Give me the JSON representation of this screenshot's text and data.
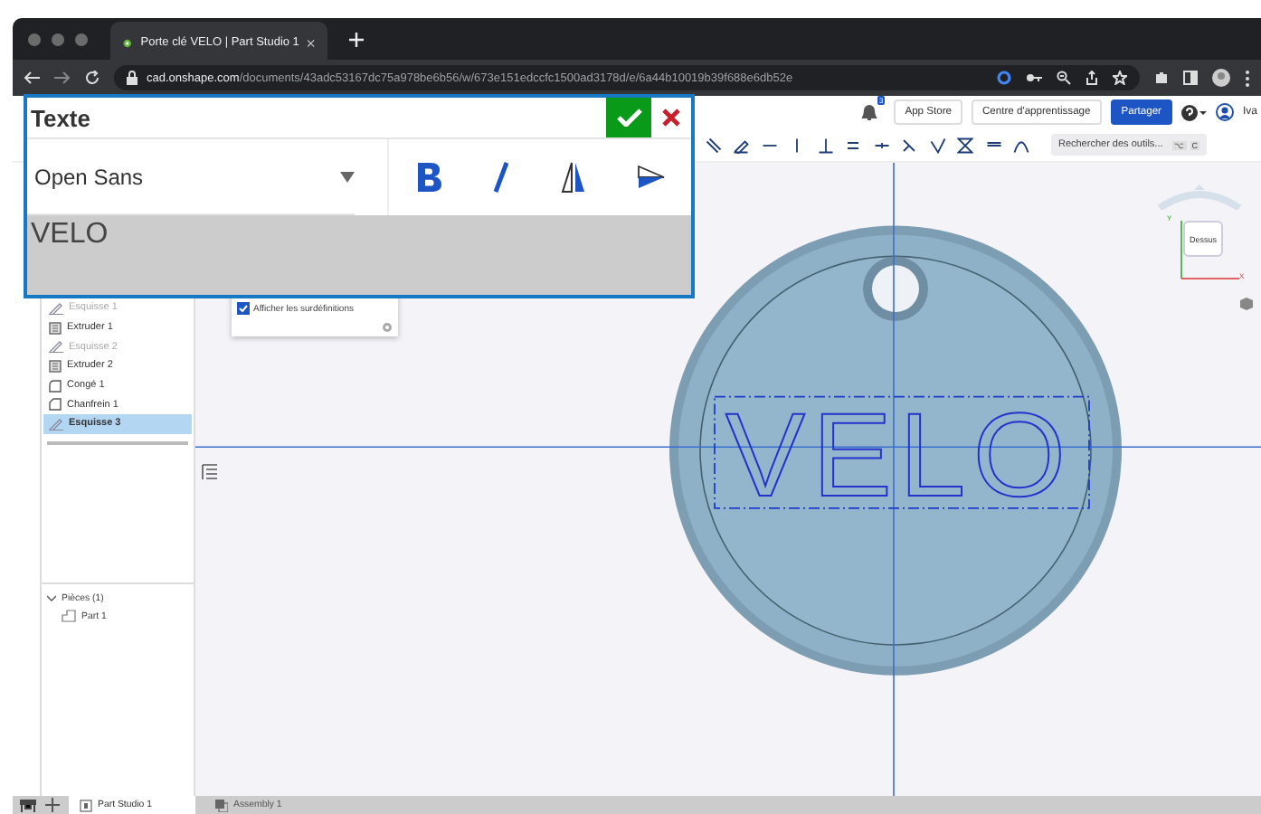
{
  "browser": {
    "tab_title": "Porte clé VELO | Part Studio 1",
    "url_host": "cad.onshape.com",
    "url_path": "/documents/43adc53167dc75a978be6b56/w/673e151edccfc1500ad3178d/e/6a44b10019b39f688e6db52e"
  },
  "header": {
    "notification_count": "3",
    "buttons": [
      "App Store",
      "Centre d'apprentissage"
    ],
    "share_button": "Partager",
    "user": "Iva"
  },
  "toolbar": {
    "search_placeholder": "Rechercher des outils...",
    "shortcut_keys": [
      "⌥",
      "C"
    ]
  },
  "text_dialog": {
    "title": "Texte",
    "font": "Open Sans",
    "value": "VELO"
  },
  "feature_list": [
    {
      "label": "Esquisse 1",
      "kind": "sketch",
      "visible": false,
      "selected": false
    },
    {
      "label": "Extruder 1",
      "kind": "extrude",
      "visible": true,
      "selected": false
    },
    {
      "label": "Esquisse 2",
      "kind": "sketch",
      "visible": false,
      "selected": false
    },
    {
      "label": "Extruder 2",
      "kind": "extrude",
      "visible": true,
      "selected": false
    },
    {
      "label": "Congé 1",
      "kind": "fillet",
      "visible": true,
      "selected": false
    },
    {
      "label": "Chanfrein 1",
      "kind": "chamfer",
      "visible": true,
      "selected": false
    },
    {
      "label": "Esquisse 3",
      "kind": "sketch",
      "visible": true,
      "selected": true
    }
  ],
  "parts": {
    "label": "Pièces (1)",
    "expanded": true,
    "children": [
      {
        "label": "Part 1"
      }
    ]
  },
  "overlay_popup": {
    "label": "Afficher les surdéfinitions",
    "checked": true
  },
  "viewport": {
    "sketch_text": "VELO",
    "view_cube": {
      "face": "Dessus",
      "axes": [
        "Y",
        "X"
      ]
    }
  },
  "bottom_tabs": [
    {
      "label": "Part Studio 1",
      "kind": "part_studio",
      "selected": true
    },
    {
      "label": "Assembly 1",
      "kind": "assembly",
      "selected": false
    }
  ]
}
